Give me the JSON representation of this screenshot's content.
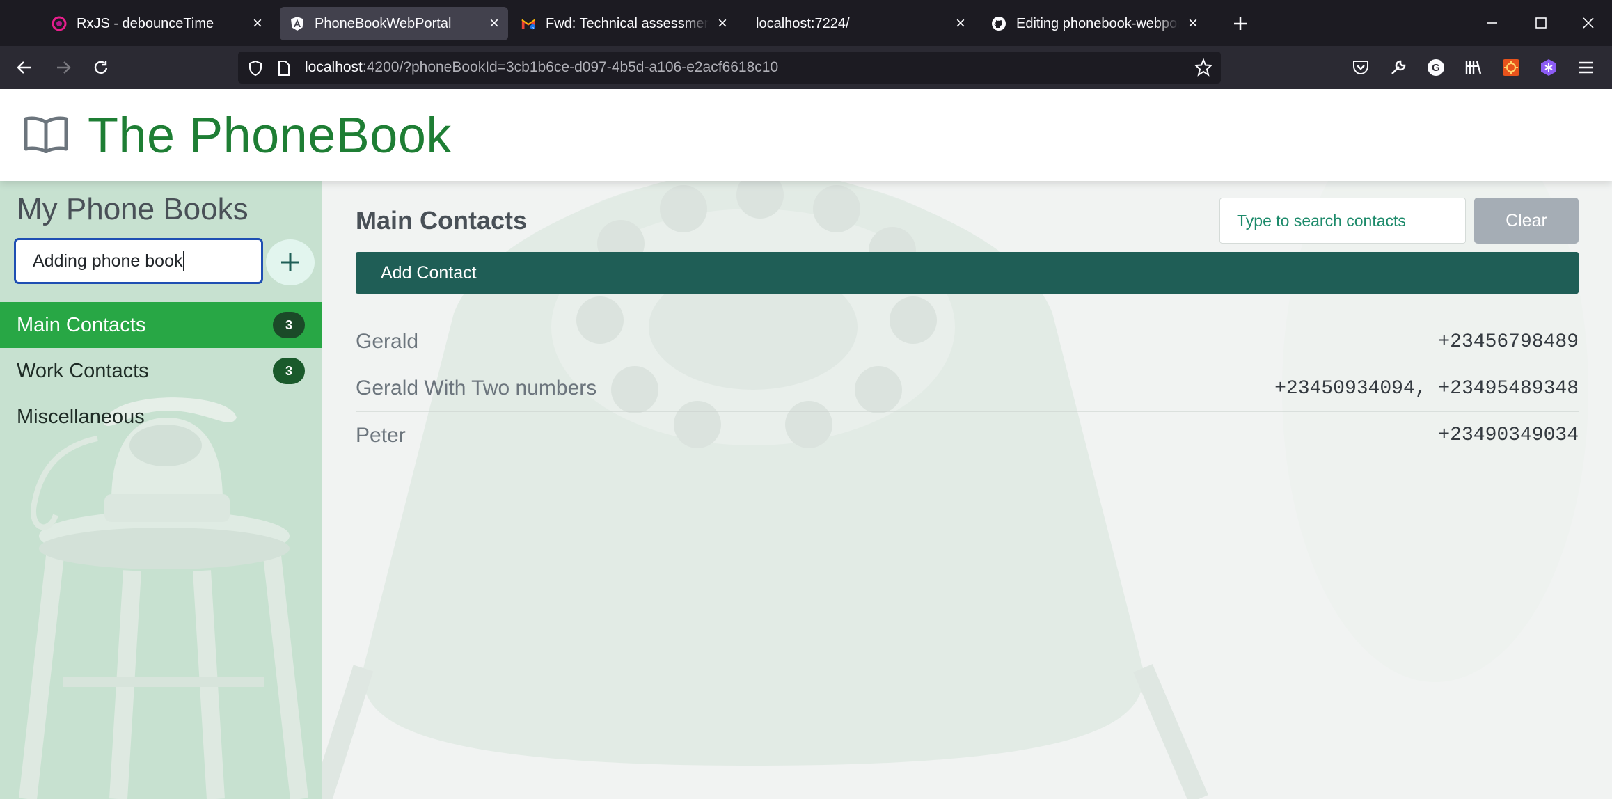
{
  "browser": {
    "tabs": [
      {
        "title": "RxJS - debounceTime",
        "icon": "rxjs-icon",
        "active": false
      },
      {
        "title": "PhoneBookWebPortal",
        "icon": "angular-icon",
        "active": true
      },
      {
        "title": "Fwd: Technical assessment Gerald",
        "icon": "gmail-icon",
        "active": false
      },
      {
        "title": "localhost:7224/",
        "icon": "none",
        "active": false
      },
      {
        "title": "Editing phonebook-webportal/README.md",
        "icon": "github-icon",
        "active": false
      }
    ],
    "url_host": "localhost",
    "url_rest": ":4200/?phoneBookId=3cb1b6ce-d097-4b5d-a106-e2acf6618c10"
  },
  "header": {
    "title": "The PhoneBook"
  },
  "sidebar": {
    "title": "My Phone Books",
    "new_book_value": "Adding phone book",
    "books": [
      {
        "name": "Main Contacts",
        "count": "3",
        "active": true
      },
      {
        "name": "Work Contacts",
        "count": "3",
        "active": false
      },
      {
        "name": "Miscellaneous",
        "count": "",
        "active": false
      }
    ]
  },
  "main": {
    "title": "Main Contacts",
    "search_placeholder": "Type to search contacts",
    "clear_label": "Clear",
    "add_contact_label": "Add Contact",
    "contacts": [
      {
        "name": "Gerald",
        "phones": "+23456798489"
      },
      {
        "name": "Gerald With Two numbers",
        "phones": "+23450934094, +23495489348"
      },
      {
        "name": "Peter",
        "phones": "+23490349034"
      }
    ]
  },
  "colors": {
    "brand_green": "#1e7e34",
    "active_book": "#28a745",
    "add_contact_bg": "#1f5e56",
    "clear_btn_bg": "#a5adb5",
    "sidebar_bg": "#c7e1d0"
  }
}
